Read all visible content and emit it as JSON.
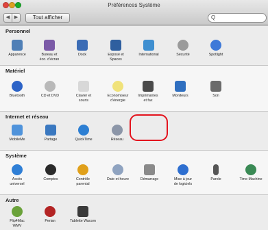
{
  "window": {
    "title": "Préférences Système",
    "show_all": "Tout afficher",
    "search_placeholder": ""
  },
  "sections": [
    {
      "label": "Personnel",
      "items": [
        {
          "label": "Apparence",
          "icon": "appearance-icon",
          "color": "#4f7fb6"
        },
        {
          "label": "Bureau et\néco. d'écran",
          "icon": "desktop-icon",
          "color": "#7b5aa7"
        },
        {
          "label": "Dock",
          "icon": "dock-icon",
          "color": "#3b6cb5"
        },
        {
          "label": "Exposé et\nSpaces",
          "icon": "expose-icon",
          "color": "#2f5f9f"
        },
        {
          "label": "International",
          "icon": "international-icon",
          "color": "#3f8fd0"
        },
        {
          "label": "Sécurité",
          "icon": "security-icon",
          "color": "#9a9a9a"
        },
        {
          "label": "Spotlight",
          "icon": "spotlight-icon",
          "color": "#3e79d8"
        }
      ]
    },
    {
      "label": "Matériel",
      "items": [
        {
          "label": "Bluetooth",
          "icon": "bluetooth-icon",
          "color": "#2c63c7"
        },
        {
          "label": "CD et DVD",
          "icon": "cd-dvd-icon",
          "color": "#b9b9b9"
        },
        {
          "label": "Clavier et\nsouris",
          "icon": "keyboard-mouse-icon",
          "color": "#d8d8d8"
        },
        {
          "label": "Economiseur\nd'énergie",
          "icon": "energy-saver-icon",
          "color": "#f0e27a"
        },
        {
          "label": "Imprimantes\net fax",
          "icon": "printer-icon",
          "color": "#4a4a4a"
        },
        {
          "label": "Moniteurs",
          "icon": "displays-icon",
          "color": "#2f6fc0"
        },
        {
          "label": "Son",
          "icon": "sound-icon",
          "color": "#6a6a6a"
        }
      ]
    },
    {
      "label": "Internet et réseau",
      "items": [
        {
          "label": "MobileMe",
          "icon": "mobileme-icon",
          "color": "#4f93db"
        },
        {
          "label": "Partage",
          "icon": "sharing-icon",
          "color": "#3a78c0"
        },
        {
          "label": "QuickTime",
          "icon": "quicktime-icon",
          "color": "#2d7fd3"
        },
        {
          "label": "Réseau",
          "icon": "network-icon",
          "color": "#8c96a8"
        }
      ]
    },
    {
      "label": "Système",
      "items": [
        {
          "label": "Accès\nuniversel",
          "icon": "universal-access-icon",
          "color": "#2f7fd6"
        },
        {
          "label": "Comptes",
          "icon": "accounts-icon",
          "color": "#2a2a2a"
        },
        {
          "label": "Contrôle\nparental",
          "icon": "parental-controls-icon",
          "color": "#e0a01b"
        },
        {
          "label": "Date et heure",
          "icon": "date-time-icon",
          "color": "#8fa3c0"
        },
        {
          "label": "Démarrage",
          "icon": "startup-disk-icon",
          "color": "#8a8a8a"
        },
        {
          "label": "Mise à jour\nde logiciels",
          "icon": "software-update-icon",
          "color": "#2e6fd0"
        },
        {
          "label": "Parole",
          "icon": "speech-icon",
          "color": "#555555"
        },
        {
          "label": "Time Machine",
          "icon": "time-machine-icon",
          "color": "#3a8a55"
        }
      ]
    },
    {
      "label": "Autre",
      "items": [
        {
          "label": "Flip4Mac\nWMV",
          "icon": "flip4mac-icon",
          "color": "#6aa23a"
        },
        {
          "label": "Perian",
          "icon": "perian-icon",
          "color": "#b32424"
        },
        {
          "label": "Tablette Wacom",
          "icon": "wacom-icon",
          "color": "#3a3a3a"
        }
      ]
    }
  ],
  "highlight": {
    "target": "Imprimantes\net fax",
    "color": "#e3131d"
  }
}
